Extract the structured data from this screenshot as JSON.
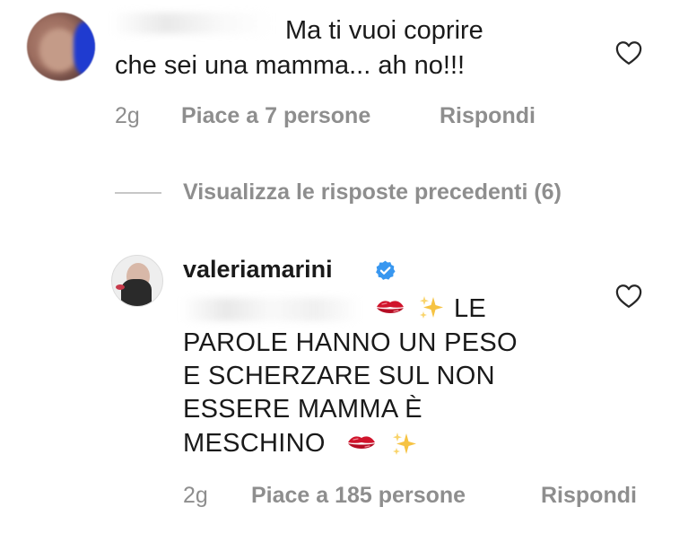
{
  "comment": {
    "text_line1": "Ma ti vuoi coprire",
    "text_line2": "che sei una mamma... ah no!!!",
    "time": "2g",
    "likes": "Piace a 7 persone",
    "reply_label": "Rispondi",
    "like_icon": "heart-outline-icon"
  },
  "thread": {
    "view_previous": "Visualizza le risposte precedenti (6)"
  },
  "reply": {
    "username": "valeriamarini",
    "verified_icon": "verified-badge-icon",
    "text_line0": "LE",
    "text_line1": "PAROLE HANNO UN PESO",
    "text_line2": "E SCHERZARE SUL NON",
    "text_line3": "ESSERE MAMMA È",
    "text_line4": "MESCHINO",
    "emoji_kiss": "💋",
    "emoji_sparkles": "✨",
    "time": "2g",
    "likes": "Piace a 185 persone",
    "reply_label": "Rispondi",
    "like_icon": "heart-outline-icon"
  },
  "colors": {
    "text": "#1a1a1a",
    "meta": "#8e8e8e",
    "verified": "#3897f0",
    "kiss": "#c8102e"
  }
}
